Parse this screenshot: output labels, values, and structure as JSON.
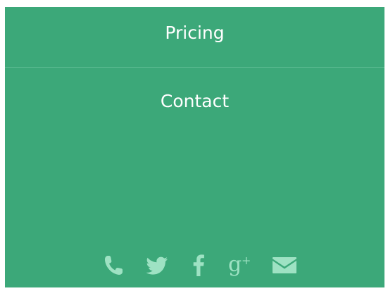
{
  "nav": {
    "items": [
      {
        "label": "Pricing"
      },
      {
        "label": "Contact"
      }
    ]
  },
  "social": {
    "icon_color": "#9ee2c3",
    "icons": [
      "phone-icon",
      "twitter-icon",
      "facebook-icon",
      "google-plus-icon",
      "email-icon"
    ],
    "gplus_letter": "g",
    "gplus_plus": "+"
  },
  "colors": {
    "panel_background": "#3ca879",
    "divider": "#5cbb91",
    "text": "#ffffff"
  }
}
